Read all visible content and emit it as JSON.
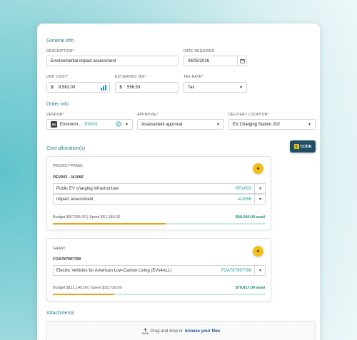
{
  "general_info": {
    "title": "General info",
    "description_label": "DESCRIPTION*",
    "description_value": "Environmental impact assessment",
    "date_label": "DATE REQUIRED",
    "date_value": "08/05/2026",
    "unit_cost_label": "UNIT COST*",
    "unit_cost_prefix": "$",
    "unit_cost_value": "8,562.00",
    "est_tax_label": "ESTIMATED TAX*",
    "est_tax_prefix": "$",
    "est_tax_value": "556.53",
    "tax_rate_label": "TAX RATE*",
    "tax_rate_value": "Tax"
  },
  "order_info": {
    "title": "Order info",
    "vendor_label": "VENDOR*",
    "vendor_badge": "EN",
    "vendor_name": "Environm...",
    "vendor_code": "ENV01",
    "approval_label": "APPROVAL*",
    "approval_value": "Assessment approval",
    "delivery_label": "DELIVERY LOCATION*",
    "delivery_value": "EV Charging Station 202"
  },
  "cost_allocation": {
    "title": "Cost allocation(s)",
    "code_button": "CODE",
    "panels": [
      {
        "type": "PROJECT-PHASE",
        "code": "PEV003 - IA1056",
        "rows": [
          {
            "label": "Public EV charging infrastructure",
            "code": "PEV003"
          },
          {
            "label": "Impact assessment",
            "code": "IA1056"
          }
        ],
        "budget": "Budget $97,235.00",
        "spent": "Spent $51,186.00",
        "avail": "$46,049.00 avail",
        "spent_fraction": 0.53
      },
      {
        "type": "GRANT",
        "code": "FOA787997789",
        "rows": [
          {
            "label": "Electric Vehicles for American Low-Carbon Living (EVs4ALL)",
            "code": "FOA787997789"
          }
        ],
        "budget": "Budget $111,145.00",
        "spent": "Spent $32,728.00",
        "avail": "$78,417.00 avail",
        "spent_fraction": 0.29
      }
    ]
  },
  "attachments": {
    "title": "Attachments",
    "drop_text": "Drag and drop or",
    "browse_text": "browse your files"
  }
}
